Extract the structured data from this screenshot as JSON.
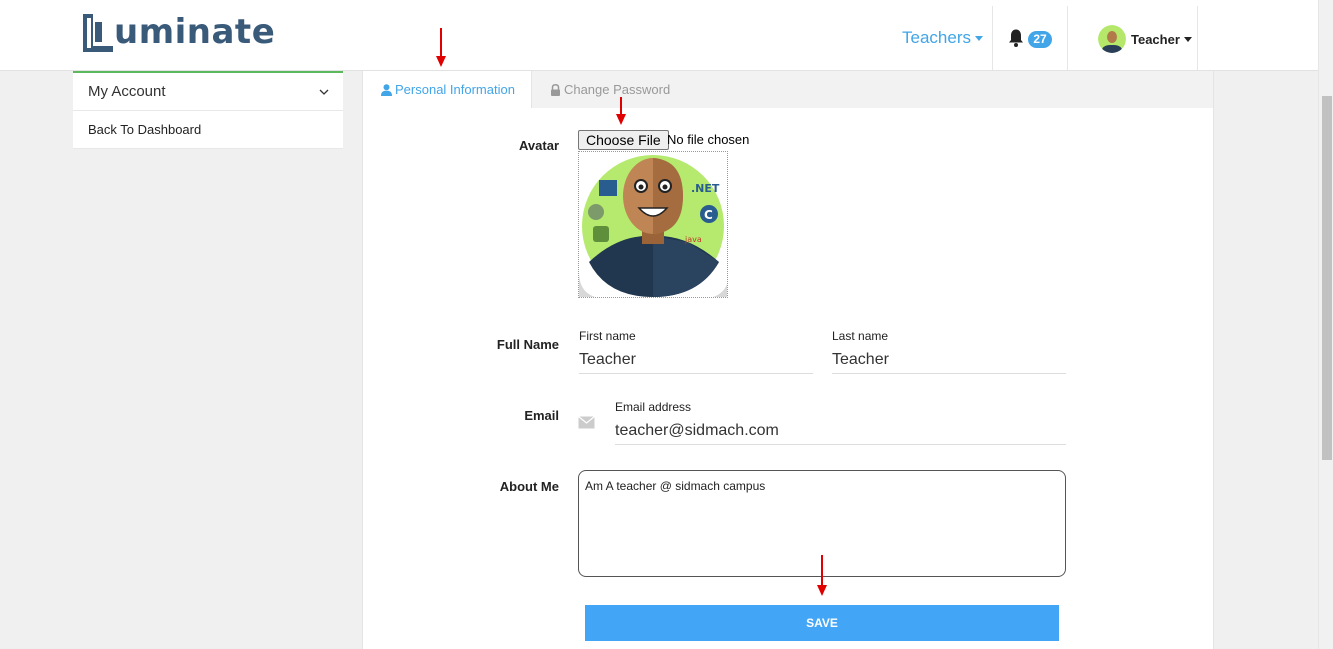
{
  "app": {
    "logo_text": "uminate"
  },
  "header": {
    "nav_teachers": "Teachers",
    "notifications_count": "27",
    "user_label": "Teacher"
  },
  "sidebar": {
    "items": [
      {
        "label": "My Account"
      },
      {
        "label": "Back To Dashboard"
      }
    ]
  },
  "tabs": [
    {
      "label": "Personal Information",
      "icon": "user-icon"
    },
    {
      "label": "Change Password",
      "icon": "lock-icon"
    }
  ],
  "form": {
    "avatar_label": "Avatar",
    "choose_file": "Choose File",
    "file_status": "No file chosen",
    "full_name_label": "Full Name",
    "first_name_label": "First name",
    "first_name_value": "Teacher",
    "last_name_label": "Last name",
    "last_name_value": "Teacher",
    "email_label": "Email",
    "email_field_label": "Email address",
    "email_value": "teacher@sidmach.com",
    "about_label": "About Me",
    "about_value": "Am A teacher @ sidmach campus",
    "save_label": "SAVE"
  },
  "colors": {
    "accent": "#42a5e8",
    "save_button": "#42a5f5",
    "sidebar_top_border": "#5cb85c",
    "annotation_arrow": "#e00000"
  }
}
